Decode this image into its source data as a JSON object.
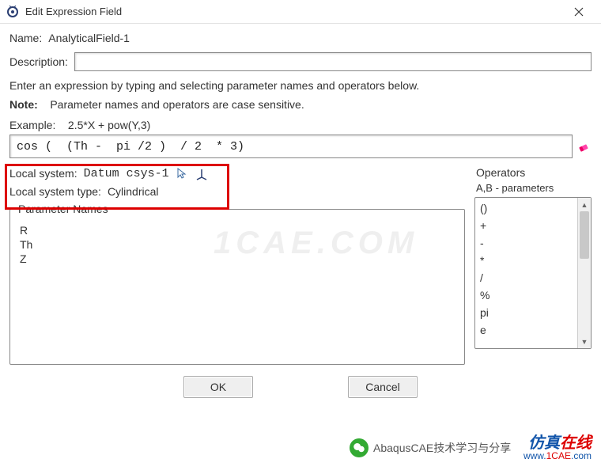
{
  "window": {
    "title": "Edit Expression Field"
  },
  "form": {
    "name_label": "Name:",
    "name_value": "AnalyticalField-1",
    "desc_label": "Description:",
    "desc_value": "",
    "instruction": "Enter an expression by typing and selecting parameter names and operators below.",
    "note_label": "Note:",
    "note_text": "Parameter names and operators are case sensitive.",
    "example_label": "Example:",
    "example_text": "2.5*X + pow(Y,3)",
    "expression": "cos (  (Th -  pi /2 )  / 2  * 3)",
    "local_system_label": "Local system:",
    "local_system_value": "Datum csys-1",
    "local_system_type_label": "Local system type:",
    "local_system_type_value": "Cylindrical"
  },
  "parameters": {
    "legend": "Parameter Names",
    "items": [
      "R",
      "Th",
      "Z"
    ]
  },
  "operators": {
    "label": "Operators",
    "sub": "A,B - parameters",
    "items": [
      "()",
      "+",
      "-",
      "*",
      "/",
      "%",
      "pi",
      "e"
    ]
  },
  "buttons": {
    "ok": "OK",
    "cancel": "Cancel"
  },
  "watermark": "1CAE.COM",
  "attribution": "AbaqusCAE技术学习与分享",
  "brand": {
    "cn_a": "仿真",
    "cn_b": "在线",
    "url_a": "www.",
    "url_b": "1CAE",
    "url_c": ".com"
  }
}
